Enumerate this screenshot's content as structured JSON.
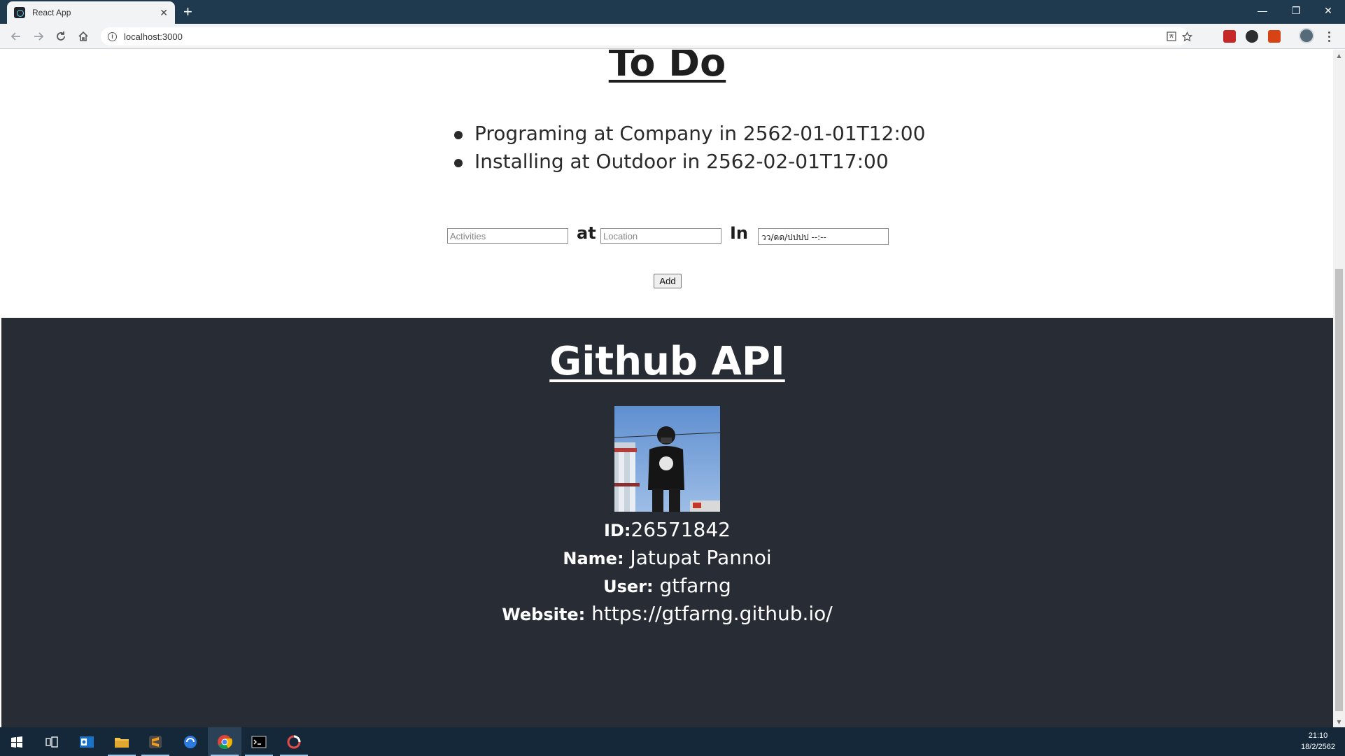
{
  "browser": {
    "tab_title": "React App",
    "tab_close": "✕",
    "new_tab": "+",
    "url": "localhost:3000",
    "info_glyph": "i",
    "window_controls": {
      "minimize": "—",
      "restore": "❐",
      "close": "✕"
    }
  },
  "todo": {
    "title": "To Do",
    "items": [
      "Programing at Company in 2562-01-01T12:00",
      "Installing at Outdoor in 2562-02-01T17:00"
    ],
    "form": {
      "activities_placeholder": "Activities",
      "at_label": "at",
      "location_placeholder": "Location",
      "in_label": "In",
      "datetime_placeholder": "วว/ดด/ปปปป --:--",
      "add_button": "Add"
    }
  },
  "github": {
    "title": "Github API",
    "id_label": "ID:",
    "id_value": "26571842",
    "name_label": "Name:",
    "name_value": " Jatupat Pannoi",
    "user_label": "User:",
    "user_value": " gtfarng",
    "website_label": "Website:",
    "website_value": " https://gtfarng.github.io/"
  },
  "taskbar": {
    "items": [
      "windows-start",
      "task-view",
      "outlook",
      "file-explorer",
      "sublime-text",
      "browser-blue",
      "chrome",
      "terminal",
      "app-red"
    ],
    "time": "21:10",
    "date": "18/2/2562"
  },
  "colors": {
    "tabbar": "#1f3a4f",
    "github_bg": "#282c34",
    "taskbar": "#14283a"
  }
}
